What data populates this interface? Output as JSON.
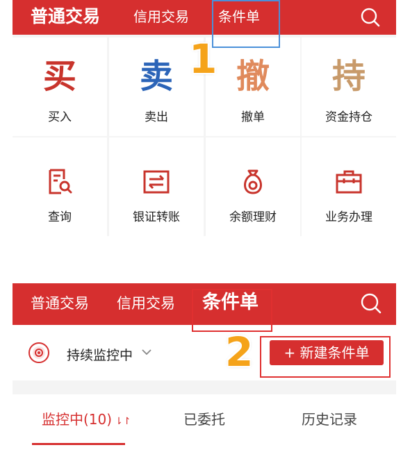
{
  "panel1": {
    "header": {
      "tabs": [
        "普通交易",
        "信用交易",
        "条件单"
      ]
    },
    "grid": [
      {
        "glyph": "买",
        "label": "买入",
        "color": "#c8342c"
      },
      {
        "glyph": "卖",
        "label": "卖出",
        "color": "#2b64b8"
      },
      {
        "glyph": "撤",
        "label": "撤单",
        "color": "#e08a5c"
      },
      {
        "glyph": "持",
        "label": "资金持仓",
        "color": "#c89a6a"
      },
      {
        "icon": "query-icon",
        "label": "查询"
      },
      {
        "icon": "bank-transfer-icon",
        "label": "银证转账"
      },
      {
        "icon": "money-bag-icon",
        "label": "余额理财"
      },
      {
        "icon": "briefcase-icon",
        "label": "业务办理"
      }
    ]
  },
  "panel2": {
    "header": {
      "tabs": [
        "普通交易",
        "信用交易",
        "条件单"
      ]
    },
    "monitor": {
      "status": "持续监控中",
      "new_button": "+ 新建条件单"
    },
    "subtabs": [
      {
        "label": "监控中(10)",
        "active": true
      },
      {
        "label": "已委托"
      },
      {
        "label": "历史记录"
      }
    ]
  },
  "annotations": {
    "step1": "1",
    "step2": "2"
  },
  "colors": {
    "brand_red": "#d62f2f",
    "annotation_blue": "#4a90d9",
    "annotation_red": "#e03030",
    "step_orange": "#f5a31a"
  }
}
